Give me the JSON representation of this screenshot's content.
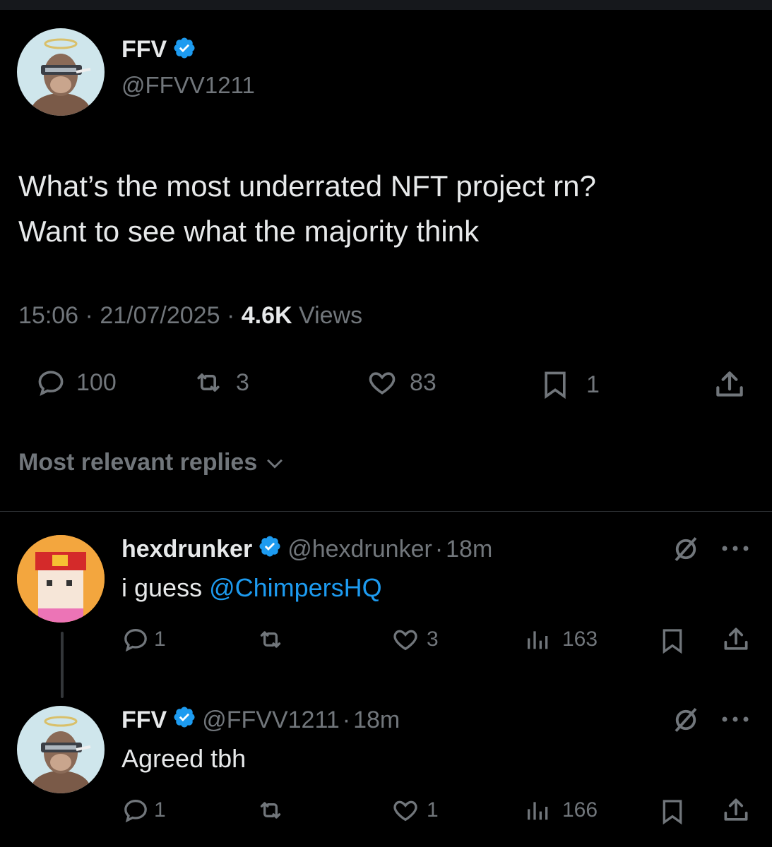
{
  "main_tweet": {
    "author_name": "FFV",
    "author_handle": "@FFVV1211",
    "text_line1": "What’s the most underrated NFT project rn?",
    "text_line2": "Want to see what the majority think",
    "time": "15:06",
    "date": "21/07/2025",
    "separator": "·",
    "views_count": "4.6K",
    "views_label": "Views",
    "replies": "100",
    "reposts": "3",
    "likes": "83",
    "bookmarks": "1"
  },
  "replies_sort": {
    "label": "Most relevant replies"
  },
  "replies": [
    {
      "author_name": "hexdrunker",
      "author_handle": "@hexdrunker",
      "age": "18m",
      "text_prefix": "i guess ",
      "mention": "@ChimpersHQ",
      "reply_count": "1",
      "like_count": "3",
      "view_count": "163"
    },
    {
      "author_name": "FFV",
      "author_handle": "@FFVV1211",
      "age": "18m",
      "text": "Agreed tbh",
      "reply_count": "1",
      "like_count": "1",
      "view_count": "166"
    }
  ],
  "colors": {
    "background": "#000000",
    "text": "#e7e9ea",
    "muted": "#71767b",
    "accent": "#1d9bf0",
    "divider": "#2f3336"
  },
  "icons": [
    "verified-badge-icon",
    "reply-icon",
    "repost-icon",
    "like-icon",
    "bookmark-icon",
    "share-icon",
    "views-icon",
    "grok-icon",
    "more-icon",
    "chevron-down-icon"
  ]
}
